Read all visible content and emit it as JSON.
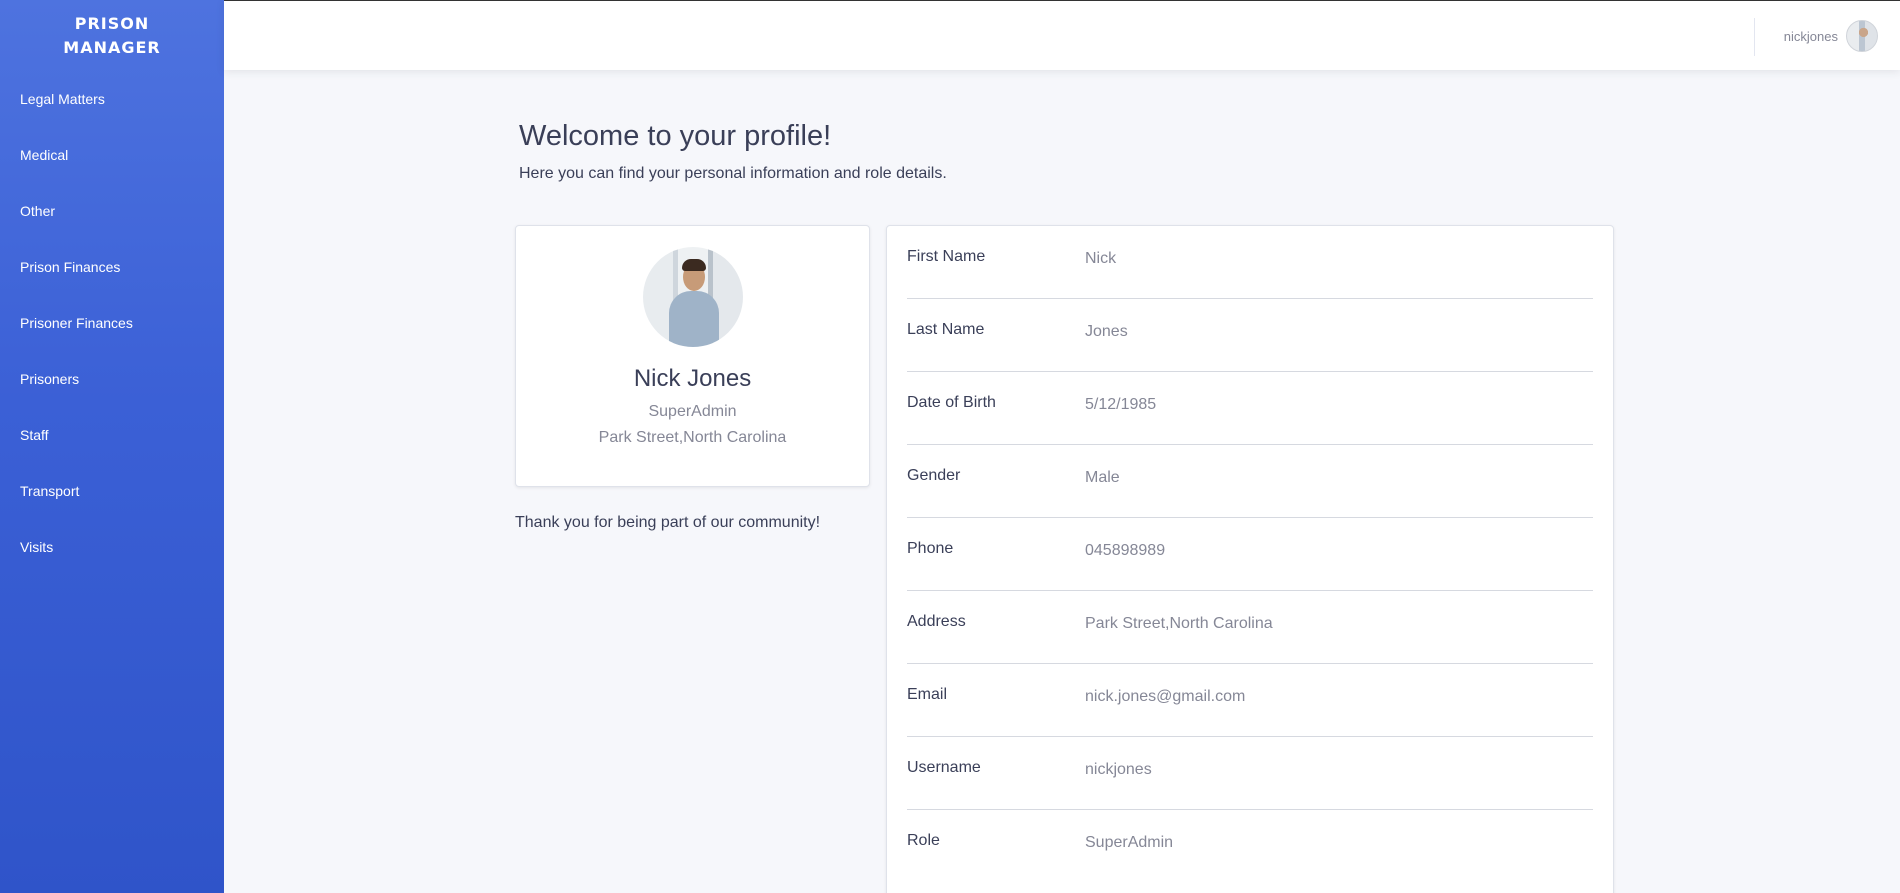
{
  "brand": {
    "line1": "PRISON",
    "line2": "MANAGER"
  },
  "sidebar": {
    "items": [
      {
        "label": "Legal Matters"
      },
      {
        "label": "Medical"
      },
      {
        "label": "Other"
      },
      {
        "label": "Prison Finances"
      },
      {
        "label": "Prisoner Finances"
      },
      {
        "label": "Prisoners"
      },
      {
        "label": "Staff"
      },
      {
        "label": "Transport"
      },
      {
        "label": "Visits"
      }
    ]
  },
  "topbar": {
    "username": "nickjones"
  },
  "main": {
    "title": "Welcome to your profile!",
    "subtitle": "Here you can find your personal information and role details.",
    "thanks": "Thank you for being part of our community!"
  },
  "profile": {
    "name": "Nick Jones",
    "role": "SuperAdmin",
    "address": "Park Street,North Carolina"
  },
  "details": [
    {
      "label": "First Name",
      "value": "Nick"
    },
    {
      "label": "Last Name",
      "value": "Jones"
    },
    {
      "label": "Date of Birth",
      "value": "5/12/1985"
    },
    {
      "label": "Gender",
      "value": "Male"
    },
    {
      "label": "Phone",
      "value": "045898989"
    },
    {
      "label": "Address",
      "value": "Park Street,North Carolina"
    },
    {
      "label": "Email",
      "value": "nick.jones@gmail.com"
    },
    {
      "label": "Username",
      "value": "nickjones"
    },
    {
      "label": "Role",
      "value": "SuperAdmin"
    }
  ],
  "colors": {
    "sidebar_top": "#4e73df",
    "sidebar_bottom": "#2f54c9",
    "background": "#f6f7fb",
    "muted_text": "#858796"
  }
}
